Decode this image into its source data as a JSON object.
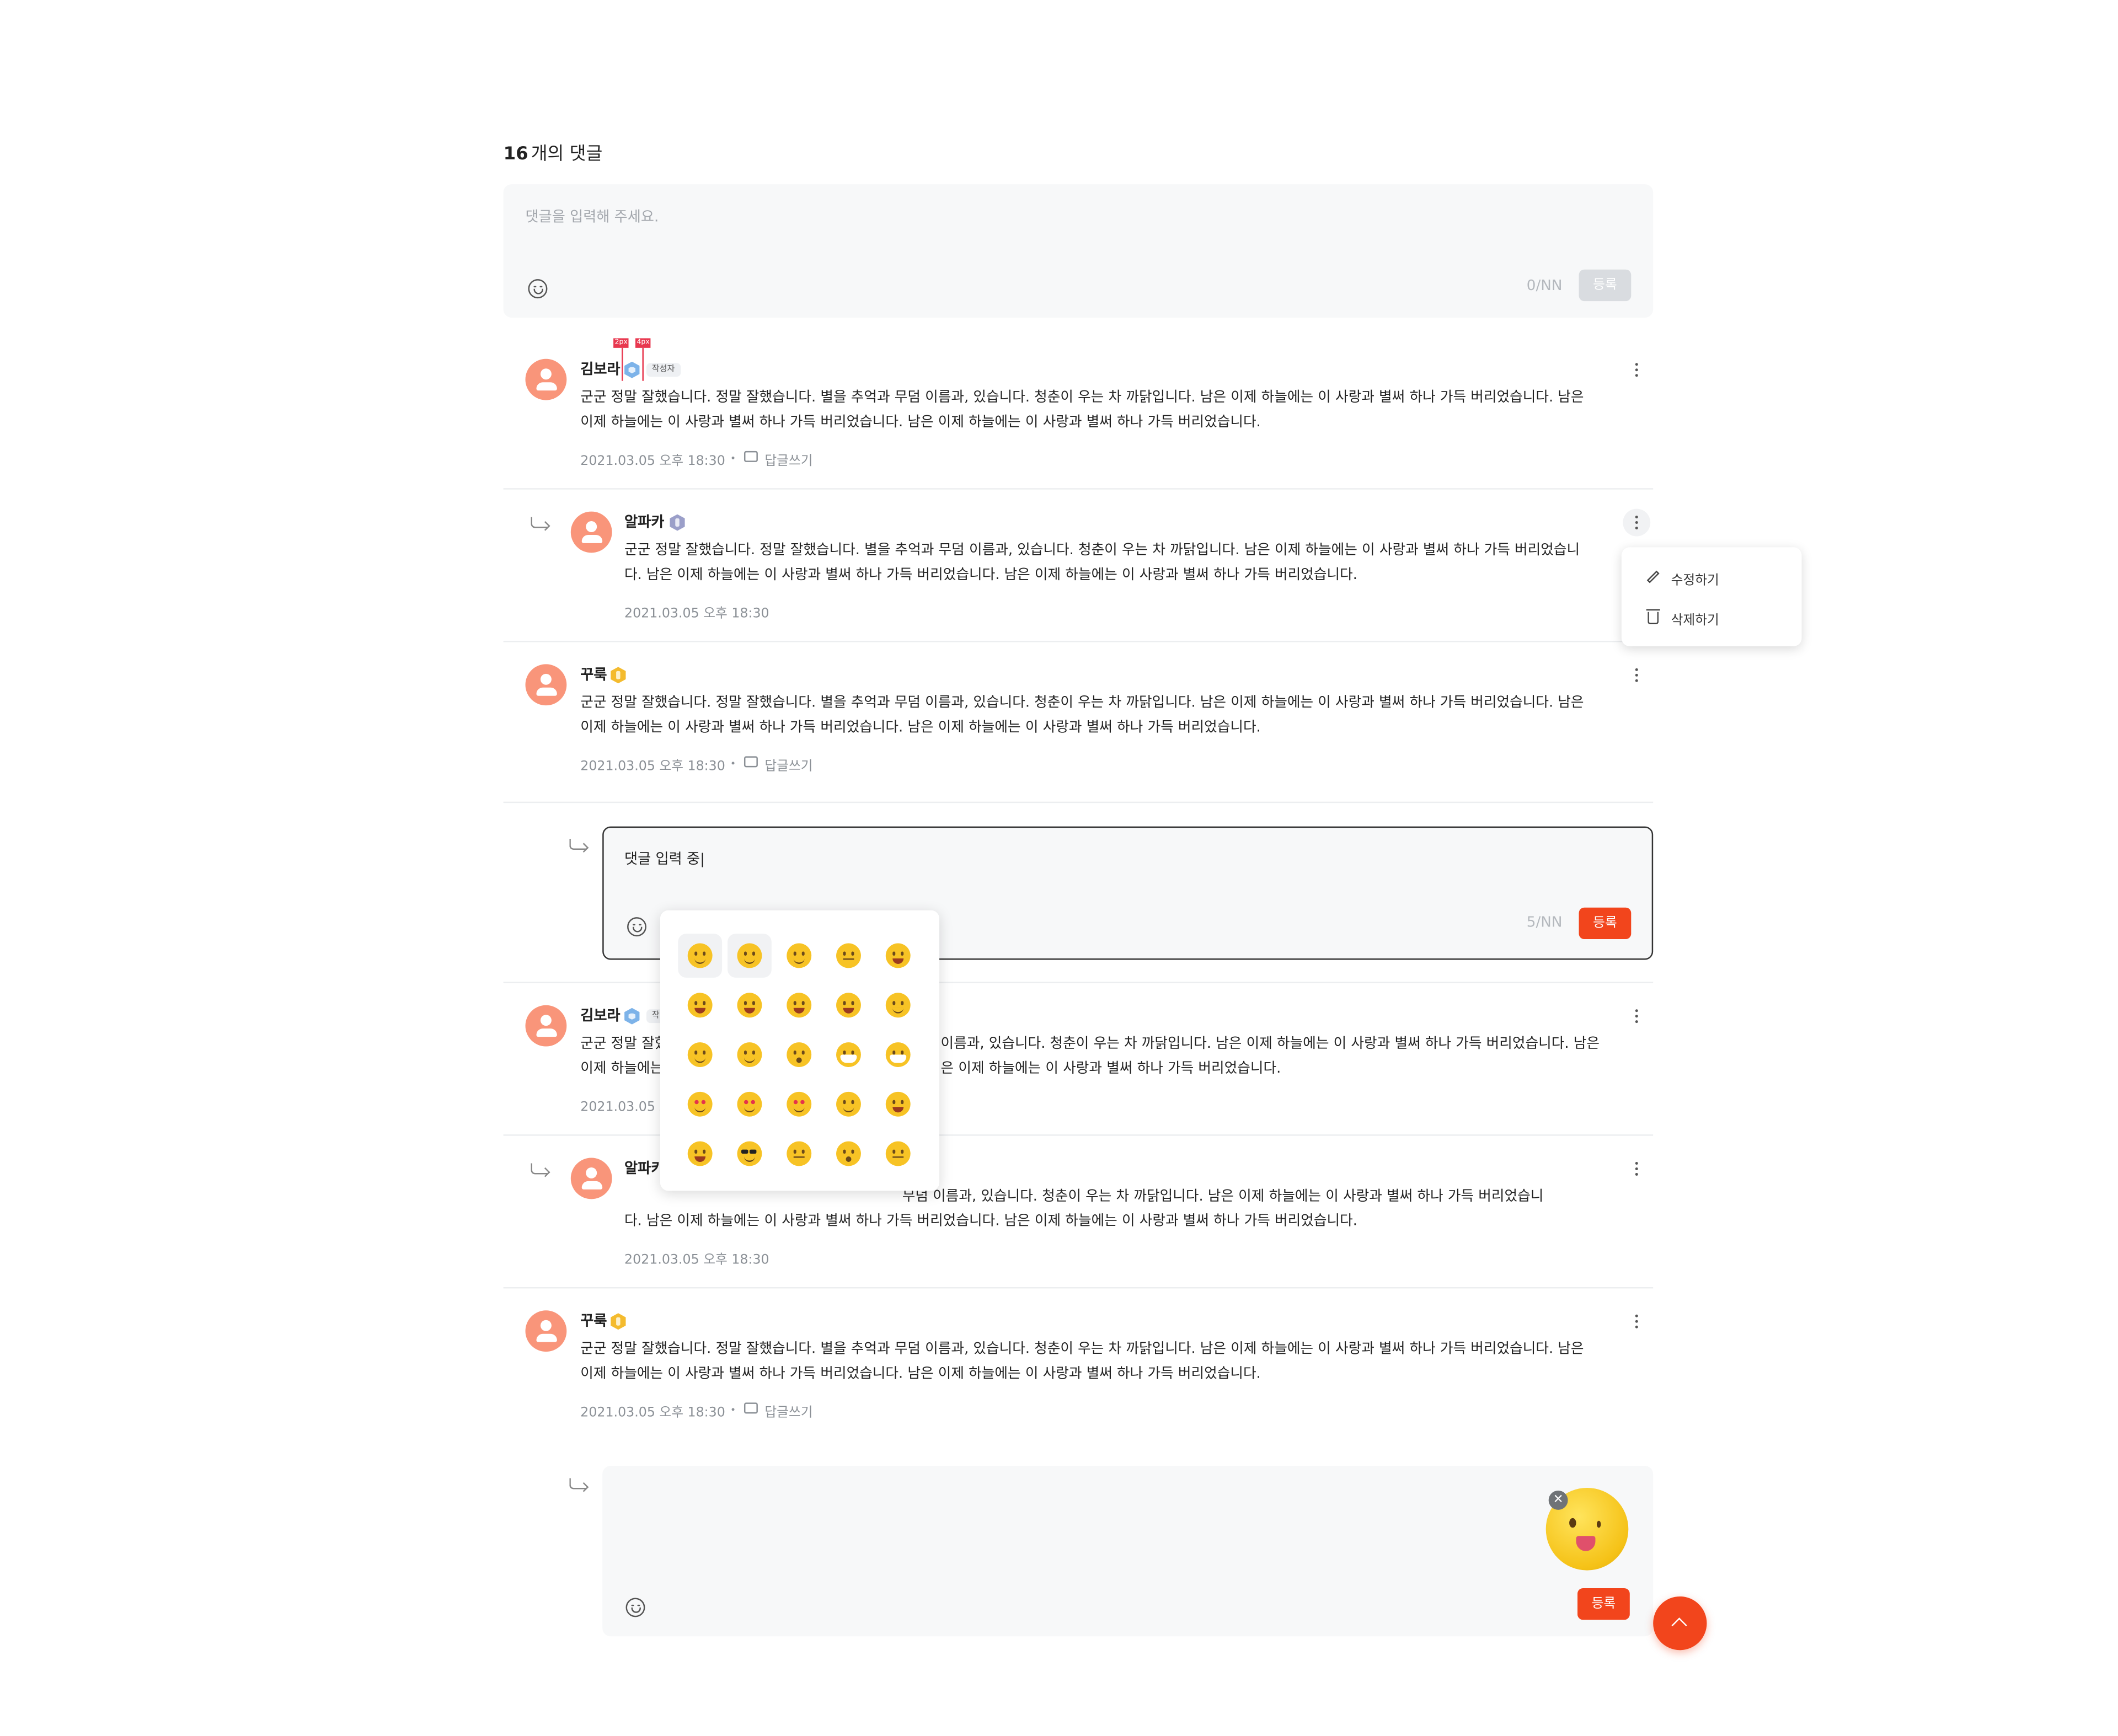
{
  "header": {
    "count": "16",
    "count_suffix": "개의 댓글"
  },
  "main_input": {
    "placeholder": "댓글을 입력해 주세요.",
    "counter": "0/NN",
    "submit_label": "등록"
  },
  "spec_marks": [
    "2px",
    "4px"
  ],
  "comments": [
    {
      "name": "김보라",
      "badge": "blue-hex",
      "tag": "작성자",
      "text_line1": "군군 정말 잘했습니다. 정말 잘했습니다. 별을 추억과 무덤 이름과, 있습니다. 청춘이 우는 차 까닭입니다. 남은 이제 하늘에는 이 사랑과 별써 하나 가득 버리었습니다. 남은",
      "text_line2": "이제 하늘에는 이 사랑과 별써 하나 가득 버리었습니다.  남은 이제 하늘에는 이 사랑과 별써 하나 가득 버리었습니다.",
      "date": "2021.03.05 오후 18:30",
      "reply_label": "답글쓰기"
    },
    {
      "name": "알파카",
      "badge": "purple",
      "text_line1": "군군 정말 잘했습니다. 정말 잘했습니다. 별을 추억과 무덤 이름과, 있습니다. 청춘이 우는 차 까닭입니다. 남은 이제 하늘에는 이 사랑과 별써 하나 가득 버리었습니",
      "text_line2": "다. 남은 이제 하늘에는 이 사랑과 별써 하나 가득 버리었습니다.  남은 이제 하늘에는 이 사랑과 별써 하나 가득 버리었습니다.",
      "date": "2021.03.05 오후 18:30"
    },
    {
      "name": "꾸룩",
      "badge": "gold",
      "text_line1": "군군 정말 잘했습니다. 정말 잘했습니다. 별을 추억과 무덤 이름과, 있습니다. 청춘이 우는 차 까닭입니다. 남은 이제 하늘에는 이 사랑과 별써 하나 가득 버리었습니다. 남은",
      "text_line2": "이제 하늘에는 이 사랑과 별써 하나 가득 버리었습니다.  남은 이제 하늘에는 이 사랑과 별써 하나 가득 버리었습니다.",
      "date": "2021.03.05 오후 18:30",
      "reply_label": "답글쓰기"
    },
    {
      "name": "김보라",
      "badge": "blue-hex",
      "tag": "작",
      "text_line1": "군군 정말 잘핬",
      "text_line1_right": "이름과, 있습니다. 청춘이 우는 차 까닭입니다. 남은 이제 하늘에는 이 사랑과 별써 하나 가득 버리었습니다. 남은",
      "text_line2": "이제 하늘에는",
      "text_line2_right": "은 이제 하늘에는 이 사랑과 별써 하나 가득 버리었습니다.",
      "date": "2021.03.05 오"
    },
    {
      "name": "알파카",
      "text_line1_right": "무덤 이름과, 있습니다. 청춘이 우는 차 까닭입니다. 남은 이제 하늘에는 이 사랑과 별써 하나 가득 버리었습니",
      "text_line2": "다. 남은 이제 하늘에는 이 사랑과 별써 하나 가득 버리었습니다.  남은 이제 하늘에는 이 사랑과 별써 하나 가득 버리었습니다.",
      "date": "2021.03.05 오후 18:30"
    },
    {
      "name": "꾸룩",
      "badge": "gold",
      "text_line1": "군군 정말 잘했습니다. 정말 잘했습니다. 별을 추억과 무덤 이름과, 있습니다. 청춘이 우는 차 까닭입니다. 남은 이제 하늘에는 이 사랑과 별써 하나 가득 버리었습니다. 남은",
      "text_line2": "이제 하늘에는 이 사랑과 별써 하나 가득 버리었습니다.  남은 이제 하늘에는 이 사랑과 별써 하나 가득 버리었습니다.",
      "date": "2021.03.05 오후 18:30",
      "reply_label": "답글쓰기"
    }
  ],
  "context_menu": {
    "edit_label": "수정하기",
    "delete_label": "삭제하기"
  },
  "reply_input_active": {
    "value": "댓글 입력 중|",
    "counter": "5/NN",
    "submit_label": "등록"
  },
  "reply_input_emoji": {
    "submit_label": "등록",
    "attached_emoji": "winking-tongue-emoji"
  },
  "emoji_picker": {
    "rows": 5,
    "cols": 5
  },
  "colors": {
    "accent": "#f2451c",
    "avatar": "#f9957a",
    "input_bg": "#f7f8f9",
    "emoji": "#f7c325"
  }
}
